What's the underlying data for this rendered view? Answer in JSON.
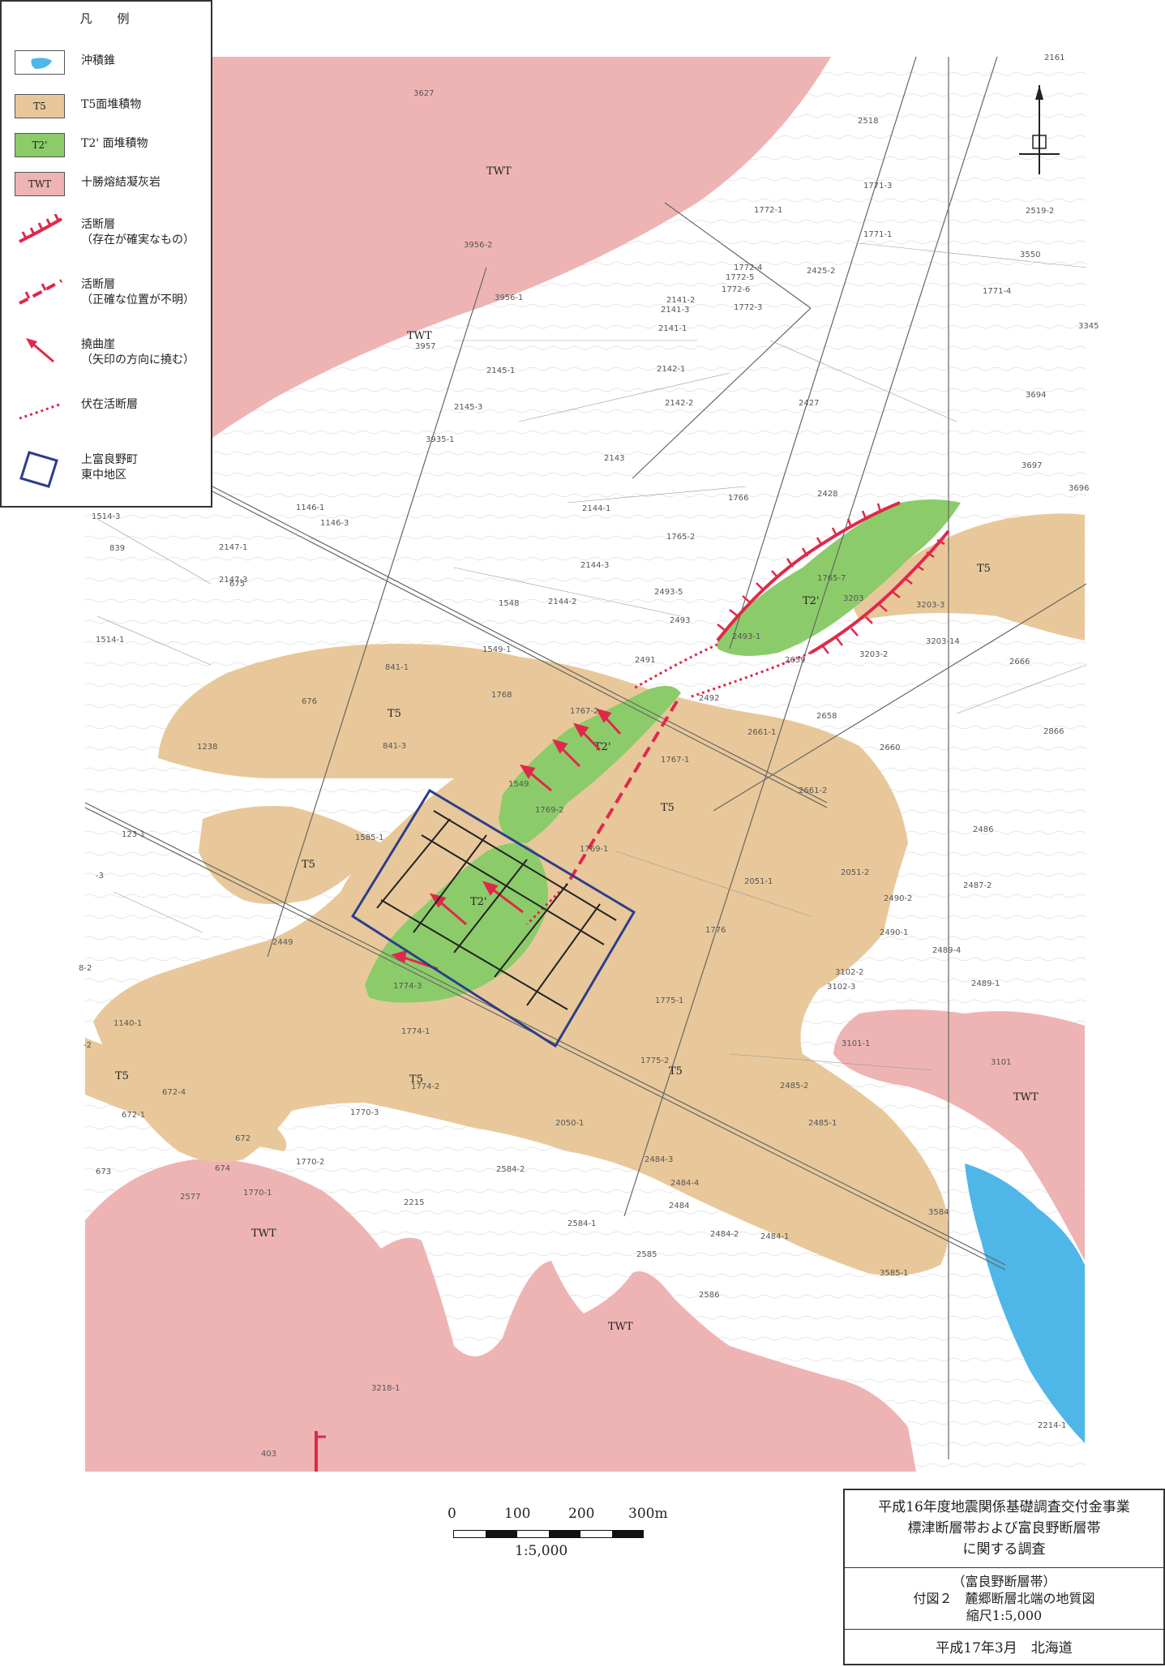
{
  "legend": {
    "title": "凡　例",
    "items": [
      {
        "key": "alluvial",
        "label": "沖積錐",
        "color": "#4fb6e8"
      },
      {
        "key": "t5",
        "swatch_text": "T5",
        "label": "T5面堆積物",
        "color": "#e8c89a"
      },
      {
        "key": "t2p",
        "swatch_text": "T2'",
        "label": "T2' 面堆積物",
        "color": "#8ccb6a"
      },
      {
        "key": "twt",
        "swatch_text": "TWT",
        "label": "十勝熔結凝灰岩",
        "color": "#eeb4b4"
      },
      {
        "key": "fault-certain",
        "label": "活断層\n（存在が確実なもの）",
        "color": "#e0284a"
      },
      {
        "key": "fault-uncertain",
        "label": "活断層\n（正確な位置が不明）",
        "color": "#e0284a"
      },
      {
        "key": "flexure",
        "label": "撓曲崖\n（矢印の方向に撓む）",
        "color": "#e0284a"
      },
      {
        "key": "concealed",
        "label": "伏在活断層",
        "color": "#e0284a"
      },
      {
        "key": "area",
        "label": "上富良野町\n東中地区",
        "color": "#2c3e8a"
      }
    ]
  },
  "map": {
    "unit_labels": {
      "twt_1": "TWT",
      "twt_2": "TWT",
      "twt_3": "TWT",
      "twt_4": "TWT",
      "twt_5": "TWT",
      "t5_1": "T5",
      "t5_2": "T5",
      "t5_3": "T5",
      "t5_4": "T5",
      "t5_5": "T5",
      "t5_6": "T5",
      "t5_7": "T5",
      "t2_1": "T2'",
      "t2_2": "T2'",
      "t2_3": "T2'"
    },
    "parcels": [
      "3627",
      "3956-2",
      "3956-1",
      "3957",
      "3935-1",
      "2145-3",
      "2145-1",
      "2143",
      "2142-1",
      "2142-2",
      "2141-2",
      "2141-3",
      "2141-1",
      "1772-4",
      "1772-5",
      "1772-6",
      "1772-3",
      "1772-1",
      "2425-2",
      "2427",
      "2518",
      "2161",
      "1771-3",
      "1771-1",
      "1771-4",
      "2519-2",
      "3550",
      "3694",
      "3697",
      "3696",
      "1766",
      "2428",
      "1765-2",
      "1765-7",
      "2493",
      "2493-1",
      "2493-5",
      "2144-1",
      "2144-3",
      "2144-2",
      "1548",
      "1549-1",
      "1549",
      "1768",
      "1767-2",
      "1767-1",
      "1769-2",
      "1769-1",
      "841-1",
      "841-3",
      "676",
      "1238",
      "1514-1",
      "1514-3",
      "1146-1",
      "1146-3",
      "2147-1",
      "2147-3",
      "839",
      "675",
      "1585-1",
      "123-1",
      "2449",
      "1774-3",
      "1774-1",
      "1774-2",
      "1775-1",
      "1775-2",
      "1776",
      "2051-1",
      "2051-2",
      "2490-2",
      "2490-1",
      "2489-4",
      "2489-1",
      "3102-2",
      "3102-3",
      "3101",
      "3101-1",
      "2486",
      "2487-2",
      "2485-2",
      "2485-1",
      "2484-3",
      "2484-4",
      "2484-2",
      "2484-1",
      "2484",
      "2050-1",
      "2584-2",
      "2584-1",
      "2585",
      "2586",
      "3584",
      "3585-1",
      "1770-3",
      "1770-2",
      "1770-1",
      "2215",
      "2577",
      "674",
      "673",
      "672",
      "672-4",
      "672-1",
      "1140-1",
      "2659",
      "2658",
      "2660",
      "2661-1",
      "2661-2",
      "2666",
      "2866",
      "3203",
      "3203-3",
      "3203-2",
      "3203-14",
      "2491",
      "2492",
      "3218-1",
      "2214-1",
      "403",
      "3345",
      "8-2",
      "-3",
      "-2"
    ]
  },
  "scale": {
    "ticks": [
      "0",
      "100",
      "200",
      "300m"
    ],
    "ratio": "1:5,000"
  },
  "titlebox": {
    "line1": "平成16年度地震関係基礎調査交付金事業",
    "line2": "標津断層帯および富良野断層帯",
    "line3": "に関する調査",
    "line4": "（富良野断層帯）",
    "line5": "付図２　麓郷断層北端の地質図",
    "line6": "縮尺1:5,000",
    "line7": "平成17年3月　北海道"
  }
}
